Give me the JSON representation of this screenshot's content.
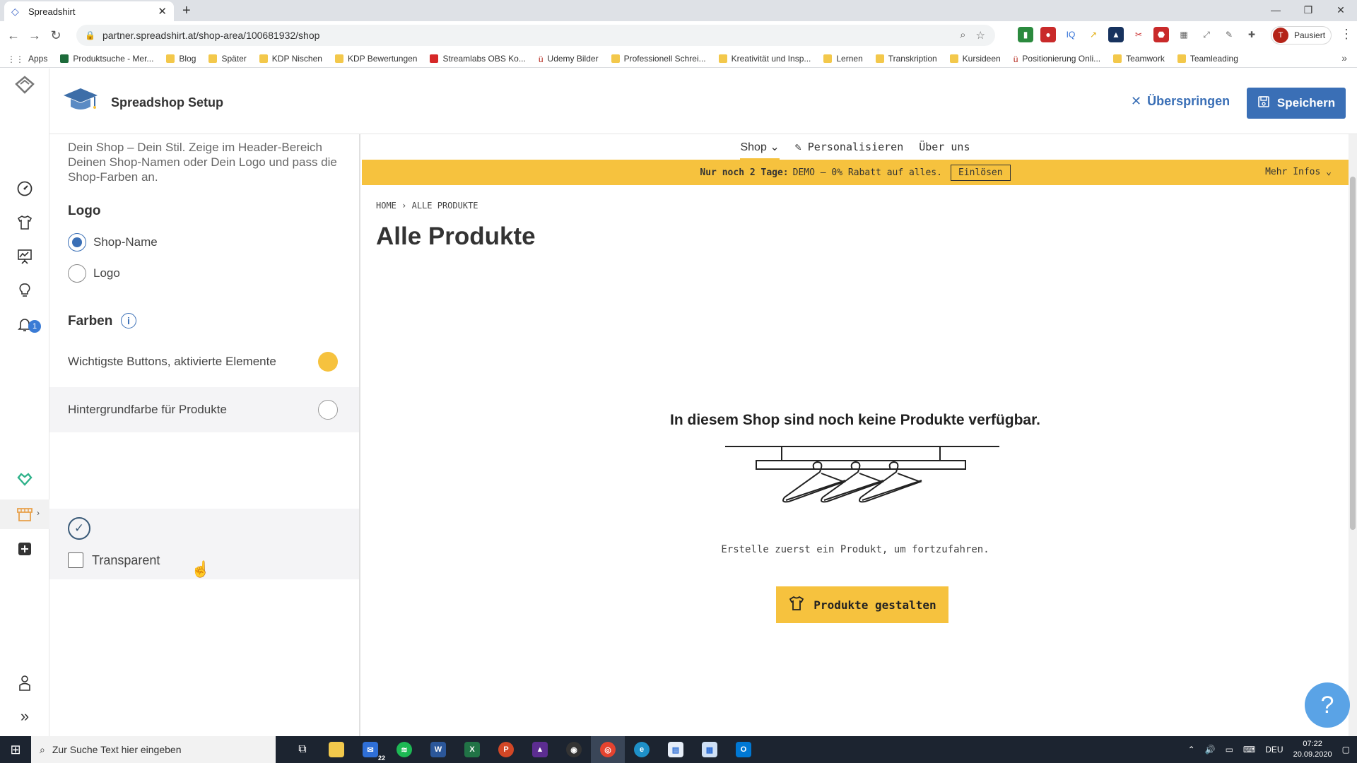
{
  "browser": {
    "tab_title": "Spreadshirt",
    "url": "partner.spreadshirt.at/shop-area/100681932/shop",
    "profile_initial": "T",
    "profile_label": "Pausiert",
    "bookmarks": [
      {
        "label": "Apps",
        "icon": "apps-grid-icon"
      },
      {
        "label": "Produktsuche - Mer...",
        "icon": "bookmark-icon"
      },
      {
        "label": "Blog",
        "icon": "folder-icon"
      },
      {
        "label": "Später",
        "icon": "folder-icon"
      },
      {
        "label": "KDP Nischen",
        "icon": "folder-icon"
      },
      {
        "label": "KDP Bewertungen",
        "icon": "folder-icon"
      },
      {
        "label": "Streamlabs OBS Ko...",
        "icon": "youtube-icon"
      },
      {
        "label": "Udemy Bilder",
        "icon": "udemy-icon"
      },
      {
        "label": "Professionell Schrei...",
        "icon": "folder-icon"
      },
      {
        "label": "Kreativität und Insp...",
        "icon": "folder-icon"
      },
      {
        "label": "Lernen",
        "icon": "folder-icon"
      },
      {
        "label": "Transkription",
        "icon": "folder-icon"
      },
      {
        "label": "Kursideen",
        "icon": "folder-icon"
      },
      {
        "label": "Positionierung Onli...",
        "icon": "udemy-icon"
      },
      {
        "label": "Teamwork",
        "icon": "folder-icon"
      },
      {
        "label": "Teamleading",
        "icon": "folder-icon"
      }
    ]
  },
  "rail": {
    "notification_count": "1"
  },
  "header": {
    "title": "Spreadshop Setup",
    "skip_label": "Überspringen",
    "save_label": "Speichern"
  },
  "panel": {
    "intro": "Dein Shop – Dein Stil. Zeige im Header-Bereich Deinen Shop-Namen oder Dein Logo und pass die Shop-Farben an.",
    "logo_title": "Logo",
    "logo_options": [
      {
        "label": "Shop-Name",
        "selected": true
      },
      {
        "label": "Logo",
        "selected": false
      }
    ],
    "colors_title": "Farben",
    "color_rows": [
      {
        "label": "Wichtigste Buttons, aktivierte Elemente",
        "color": "#F6C23E"
      },
      {
        "label": "Hintergrundfarbe für Produkte",
        "color": "#FFFFFF"
      }
    ],
    "transparent_label": "Transparent",
    "transparent_checked": false
  },
  "preview": {
    "nav": {
      "shop": "Shop",
      "personalize": "Personalisieren",
      "about": "Über uns"
    },
    "banner": {
      "bold": "Nur noch 2 Tage:",
      "text": "DEMO – 0% Rabatt auf alles.",
      "redeem": "Einlösen",
      "more": "Mehr Infos"
    },
    "breadcrumb_home": "HOME",
    "breadcrumb_current": "ALLE PRODUKTE",
    "title": "Alle Produkte",
    "empty_heading": "In diesem Shop sind noch keine Produkte verfügbar.",
    "empty_sub": "Erstelle zuerst ein Produkt, um fortzufahren.",
    "cta": "Produkte gestalten"
  },
  "taskbar": {
    "search_placeholder": "Zur Suche Text hier eingeben",
    "mail_badge": "22",
    "language": "DEU",
    "time": "07:22",
    "date": "20.09.2020"
  },
  "colors": {
    "accent": "#F6C23E",
    "brand_blue": "#3A6FB6"
  }
}
